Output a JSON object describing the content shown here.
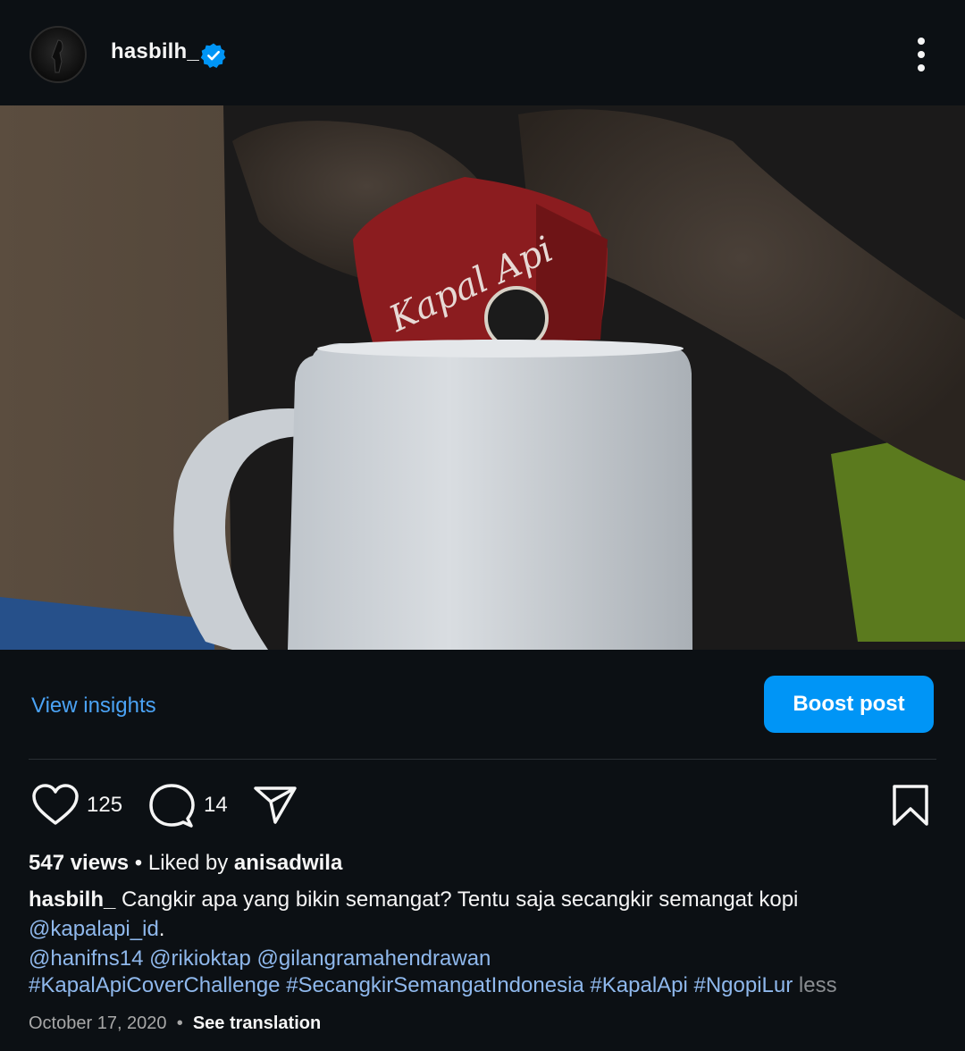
{
  "post": {
    "username": "hasbilh_",
    "verified": true
  },
  "media": {
    "product_label": "Kapal Api",
    "muted": true
  },
  "actions": {
    "view_insights": "View insights",
    "boost_post": "Boost post",
    "likes": "125",
    "comments": "14"
  },
  "stats": {
    "views": "547 views",
    "separator": "•",
    "liked_by_prefix": "Liked by",
    "liked_by_user": "anisadwila"
  },
  "caption": {
    "author": "hasbilh_",
    "text": "Cangkir apa yang bikin semangat? Tentu saja secangkir semangat kopi",
    "mention_1": "@kapalapi_id",
    "after_mention_1": ".",
    "mention_2": "@hanifns14",
    "mention_3": "@rikioktap",
    "mention_4": "@gilangramahendrawan",
    "hashtags": "#KapalApiCoverChallenge #SecangkirSemangatIndonesia #KapalApi #NgopiLur",
    "less": "less"
  },
  "footer": {
    "date": "October 17, 2020",
    "dot": "•",
    "see_translation": "See translation"
  },
  "colors": {
    "background": "#0c1014",
    "accent_link": "#4ba3f5",
    "boost_button": "#0095f6",
    "mention": "#8fb8ec",
    "verified": "#0095f6"
  },
  "icons": [
    "more-options-icon",
    "verified-badge-icon",
    "mute-icon",
    "heart-icon",
    "comment-icon",
    "share-icon",
    "bookmark-icon"
  ]
}
